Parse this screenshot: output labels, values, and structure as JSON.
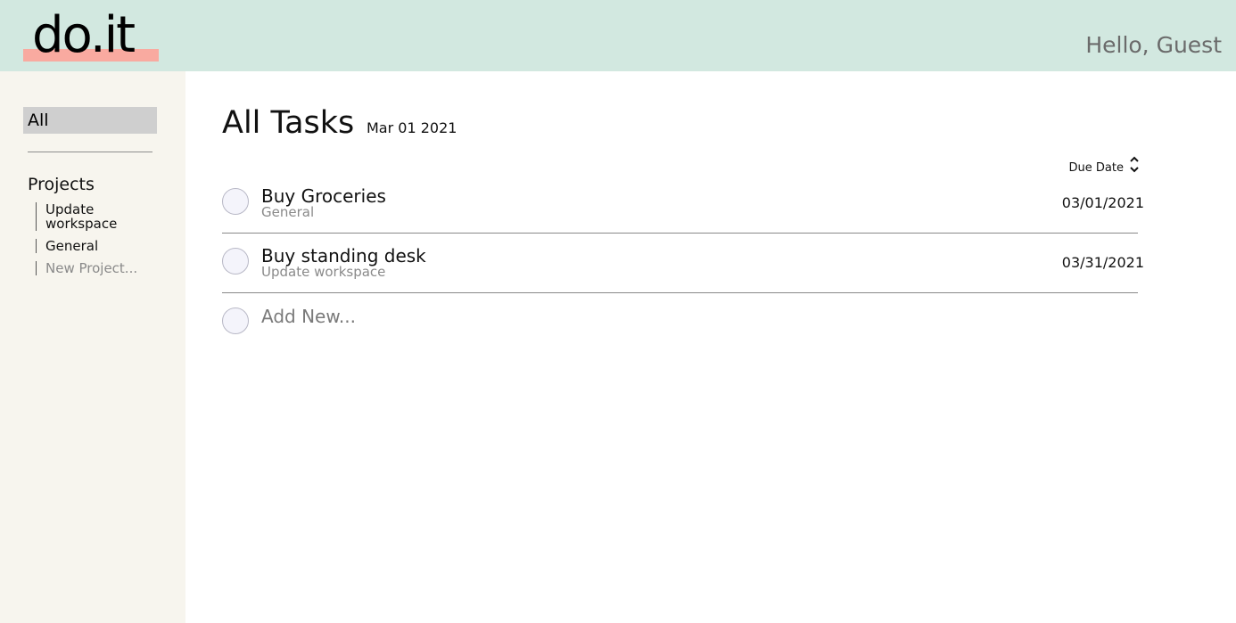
{
  "app": {
    "logo_text": "do.it",
    "greeting": "Hello, Guest"
  },
  "sidebar": {
    "all_label": "All",
    "projects_heading": "Projects",
    "projects": [
      {
        "label": "Update workspace"
      },
      {
        "label": "General"
      }
    ],
    "new_project_label": "New Project..."
  },
  "main": {
    "title": "All Tasks",
    "date": "Mar 01 2021",
    "sort": {
      "label": "Due Date",
      "icon": "sort-updown-icon"
    },
    "tasks": [
      {
        "name": "Buy Groceries",
        "project": "General",
        "due": "03/01/2021"
      },
      {
        "name": "Buy standing desk",
        "project": "Update workspace",
        "due": "03/31/2021"
      }
    ],
    "add_new_label": "Add New..."
  },
  "colors": {
    "header_bg": "#d2e8e0",
    "logo_accent": "#f9aaa0",
    "sidebar_bg": "#f7f5ee",
    "selected_nav_bg": "#cfcfcf"
  }
}
